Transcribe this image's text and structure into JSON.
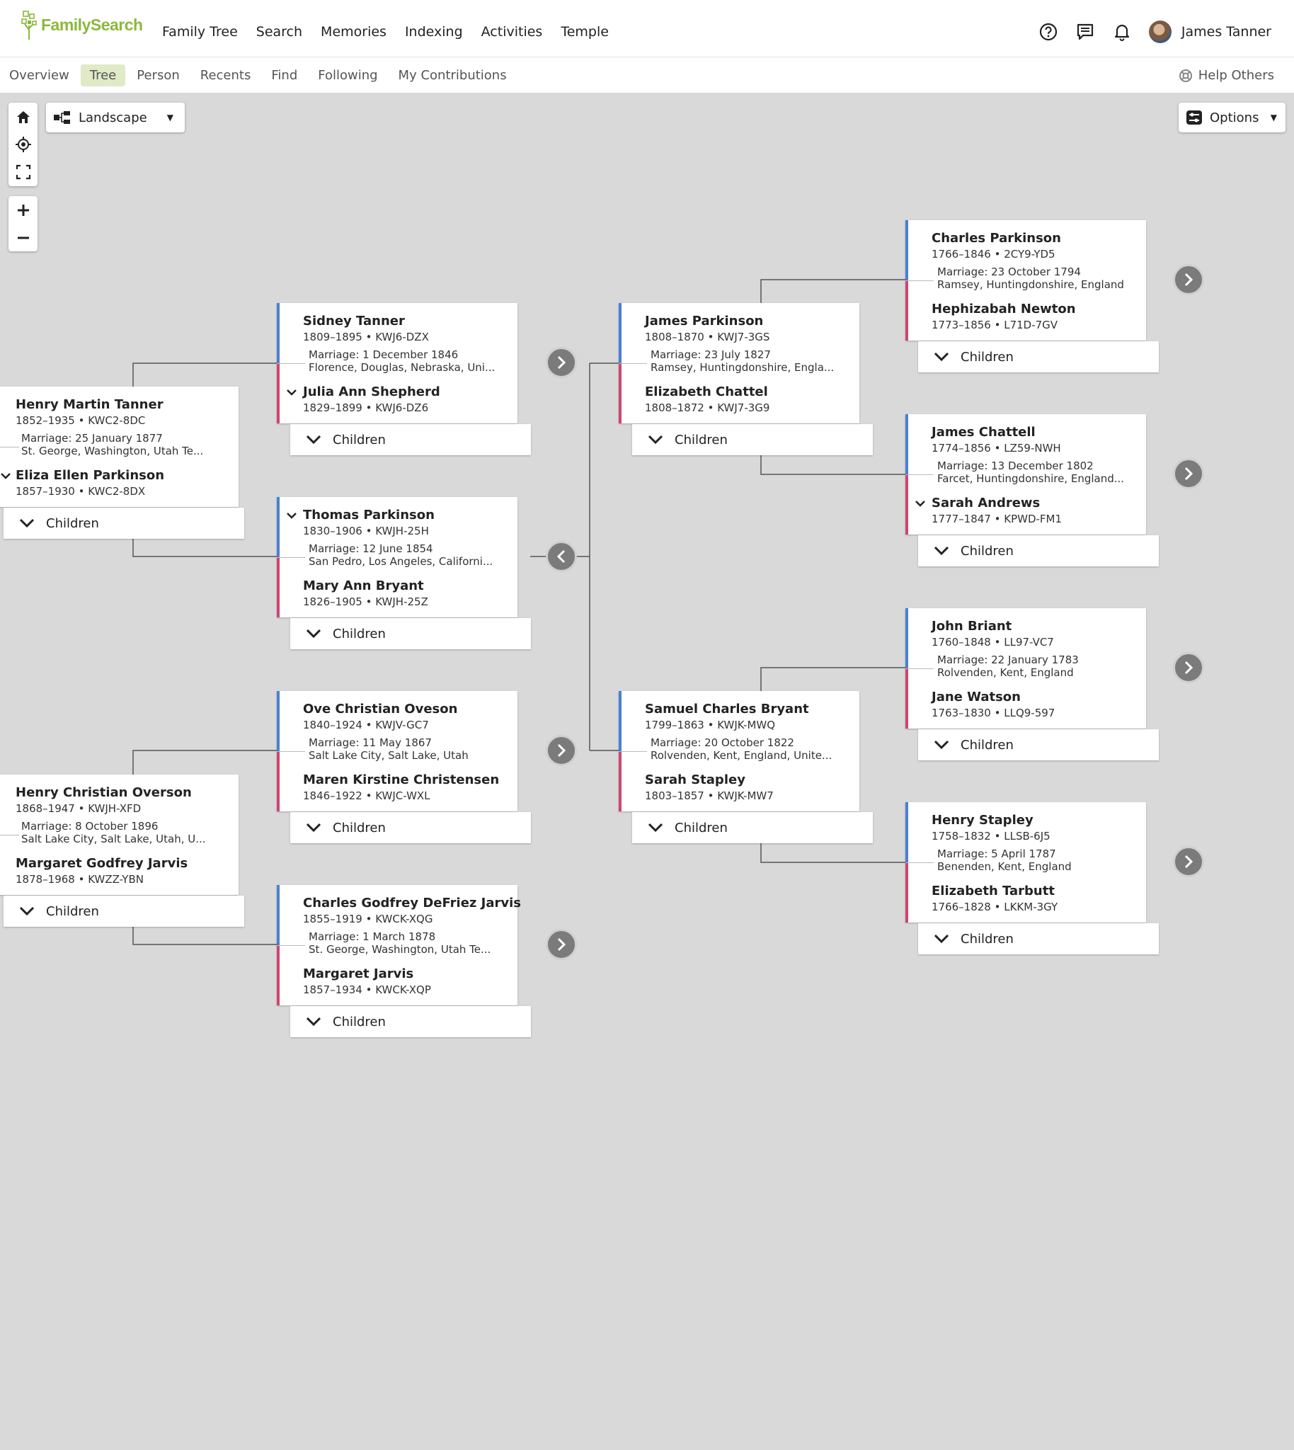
{
  "header": {
    "logo_text": "FamilySearch",
    "menu": [
      "Family Tree",
      "Search",
      "Memories",
      "Indexing",
      "Activities",
      "Temple"
    ],
    "user_name": "James Tanner",
    "icons": [
      "help-circle-icon",
      "chat-icon",
      "bell-icon"
    ]
  },
  "subnav": {
    "items": [
      "Overview",
      "Tree",
      "Person",
      "Recents",
      "Find",
      "Following",
      "My Contributions"
    ],
    "active": "Tree",
    "help_others": "Help Others"
  },
  "controls": {
    "view_label": "Landscape",
    "options_label": "Options"
  },
  "colors": {
    "male_bar": "#4a7fd6",
    "female_bar": "#d2446d",
    "logo_green": "#8cb83b",
    "active_tab_bg": "#dfeac6"
  },
  "children_label": "Children",
  "couples": [
    {
      "husband": "Henry Martin Tanner",
      "husband_info": "1852–1935 • KWC2-8DC",
      "marriage": "Marriage: 25 January 1877",
      "place": "St. George, Washington, Utah Te...",
      "wife": "Eliza Ellen Parkinson",
      "wife_info": "1857–1930 • KWC2-8DX"
    },
    {
      "husband": "Henry Christian Overson",
      "husband_info": "1868–1947 • KWJH-XFD",
      "marriage": "Marriage: 8 October 1896",
      "place": "Salt Lake City, Salt Lake, Utah, U...",
      "wife": "Margaret Godfrey Jarvis",
      "wife_info": "1878–1968 • KWZZ-YBN"
    },
    {
      "husband": "Sidney Tanner",
      "husband_info": "1809–1895 • KWJ6-DZX",
      "marriage": "Marriage: 1 December 1846",
      "place": "Florence, Douglas, Nebraska, Uni...",
      "wife": "Julia Ann Shepherd",
      "wife_info": "1829–1899 • KWJ6-DZ6"
    },
    {
      "husband": "Thomas Parkinson",
      "husband_info": "1830–1906 • KWJH-25H",
      "marriage": "Marriage: 12 June 1854",
      "place": "San Pedro, Los Angeles, Californi...",
      "wife": "Mary Ann Bryant",
      "wife_info": "1826–1905 • KWJH-25Z"
    },
    {
      "husband": "Ove Christian Oveson",
      "husband_info": "1840–1924 • KWJV-GC7",
      "marriage": "Marriage: 11 May 1867",
      "place": "Salt Lake City, Salt Lake, Utah",
      "wife": "Maren Kirstine Christensen",
      "wife_info": "1846–1922 • KWJC-WXL"
    },
    {
      "husband": "Charles Godfrey DeFriez Jarvis",
      "husband_info": "1855–1919 • KWCK-XQG",
      "marriage": "Marriage: 1 March 1878",
      "place": "St. George, Washington, Utah Te...",
      "wife": "Margaret Jarvis",
      "wife_info": "1857–1934 • KWCK-XQP"
    },
    {
      "husband": "James Parkinson",
      "husband_info": "1808–1870 • KWJ7-3GS",
      "marriage": "Marriage: 23 July 1827",
      "place": "Ramsey, Huntingdonshire, Engla...",
      "wife": "Elizabeth Chattel",
      "wife_info": "1808–1872 • KWJ7-3G9"
    },
    {
      "husband": "Samuel Charles Bryant",
      "husband_info": "1799–1863 • KWJK-MWQ",
      "marriage": "Marriage: 20 October 1822",
      "place": "Rolvenden, Kent, England, Unite...",
      "wife": "Sarah Stapley",
      "wife_info": "1803–1857 • KWJK-MW7"
    },
    {
      "husband": "Charles Parkinson",
      "husband_info": "1766–1846 • 2CY9-YD5",
      "marriage": "Marriage: 23 October 1794",
      "place": "Ramsey, Huntingdonshire, England",
      "wife": "Hephizabah Newton",
      "wife_info": "1773–1856 • L71D-7GV"
    },
    {
      "husband": "James Chattell",
      "husband_info": "1774–1856 • LZ59-NWH",
      "marriage": "Marriage: 13 December 1802",
      "place": "Farcet, Huntingdonshire, England...",
      "wife": "Sarah Andrews",
      "wife_info": "1777–1847 • KPWD-FM1"
    },
    {
      "husband": "John Briant",
      "husband_info": "1760–1848 • LL97-VC7",
      "marriage": "Marriage: 22 January 1783",
      "place": "Rolvenden, Kent, England",
      "wife": "Jane Watson",
      "wife_info": "1763–1830 • LLQ9-597"
    },
    {
      "husband": "Henry Stapley",
      "husband_info": "1758–1832 • LLSB-6J5",
      "marriage": "Marriage: 5 April 1787",
      "place": "Benenden, Kent, England",
      "wife": "Elizabeth Tarbutt",
      "wife_info": "1766–1828 • LKKM-3GY"
    }
  ]
}
